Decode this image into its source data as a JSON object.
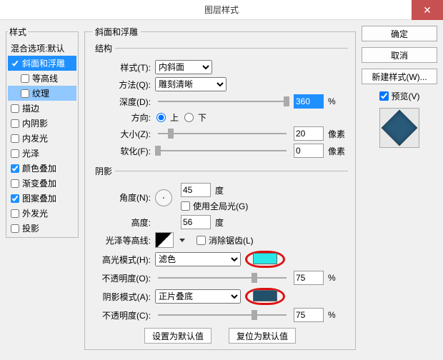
{
  "title": "图层样式",
  "left": {
    "legend": "样式",
    "blend": "混合选项:默认",
    "bevel": "斜面和浮雕",
    "contour": "等高线",
    "texture": "纹理",
    "stroke": "描边",
    "innerShadow": "内阴影",
    "innerGlow": "内发光",
    "satin": "光泽",
    "colorOverlay": "颜色叠加",
    "gradientOverlay": "渐变叠加",
    "patternOverlay": "图案叠加",
    "outerGlow": "外发光",
    "dropShadow": "投影"
  },
  "struct": {
    "legend": "斜面和浮雕",
    "inner": "结构",
    "styleLab": "样式(T):",
    "styleVal": "内斜面",
    "methodLab": "方法(Q):",
    "methodVal": "雕刻清晰",
    "depthLab": "深度(D):",
    "depthVal": "360",
    "pct": "%",
    "dirLab": "方向:",
    "up": "上",
    "down": "下",
    "sizeLab": "大小(Z):",
    "sizeVal": "20",
    "px": "像素",
    "softenLab": "软化(F):",
    "softenVal": "0"
  },
  "shade": {
    "legend": "阴影",
    "angleLab": "角度(N):",
    "angleVal": "45",
    "deg": "度",
    "globalLight": "使用全局光(G)",
    "altLab": "高度:",
    "altVal": "56",
    "glossLab": "光泽等高线:",
    "antialias": "消除锯齿(L)",
    "hiModeLab": "高光模式(H):",
    "hiModeVal": "滤色",
    "hiOpLab": "不透明度(O):",
    "hiOpVal": "75",
    "shModeLab": "阴影模式(A):",
    "shModeVal": "正片叠底",
    "shOpLab": "不透明度(C):",
    "shOpVal": "75",
    "pct": "%"
  },
  "footer": {
    "reset": "设置为默认值",
    "revert": "复位为默认值"
  },
  "right": {
    "ok": "确定",
    "cancel": "取消",
    "newStyle": "新建样式(W)...",
    "preview": "预览(V)"
  }
}
